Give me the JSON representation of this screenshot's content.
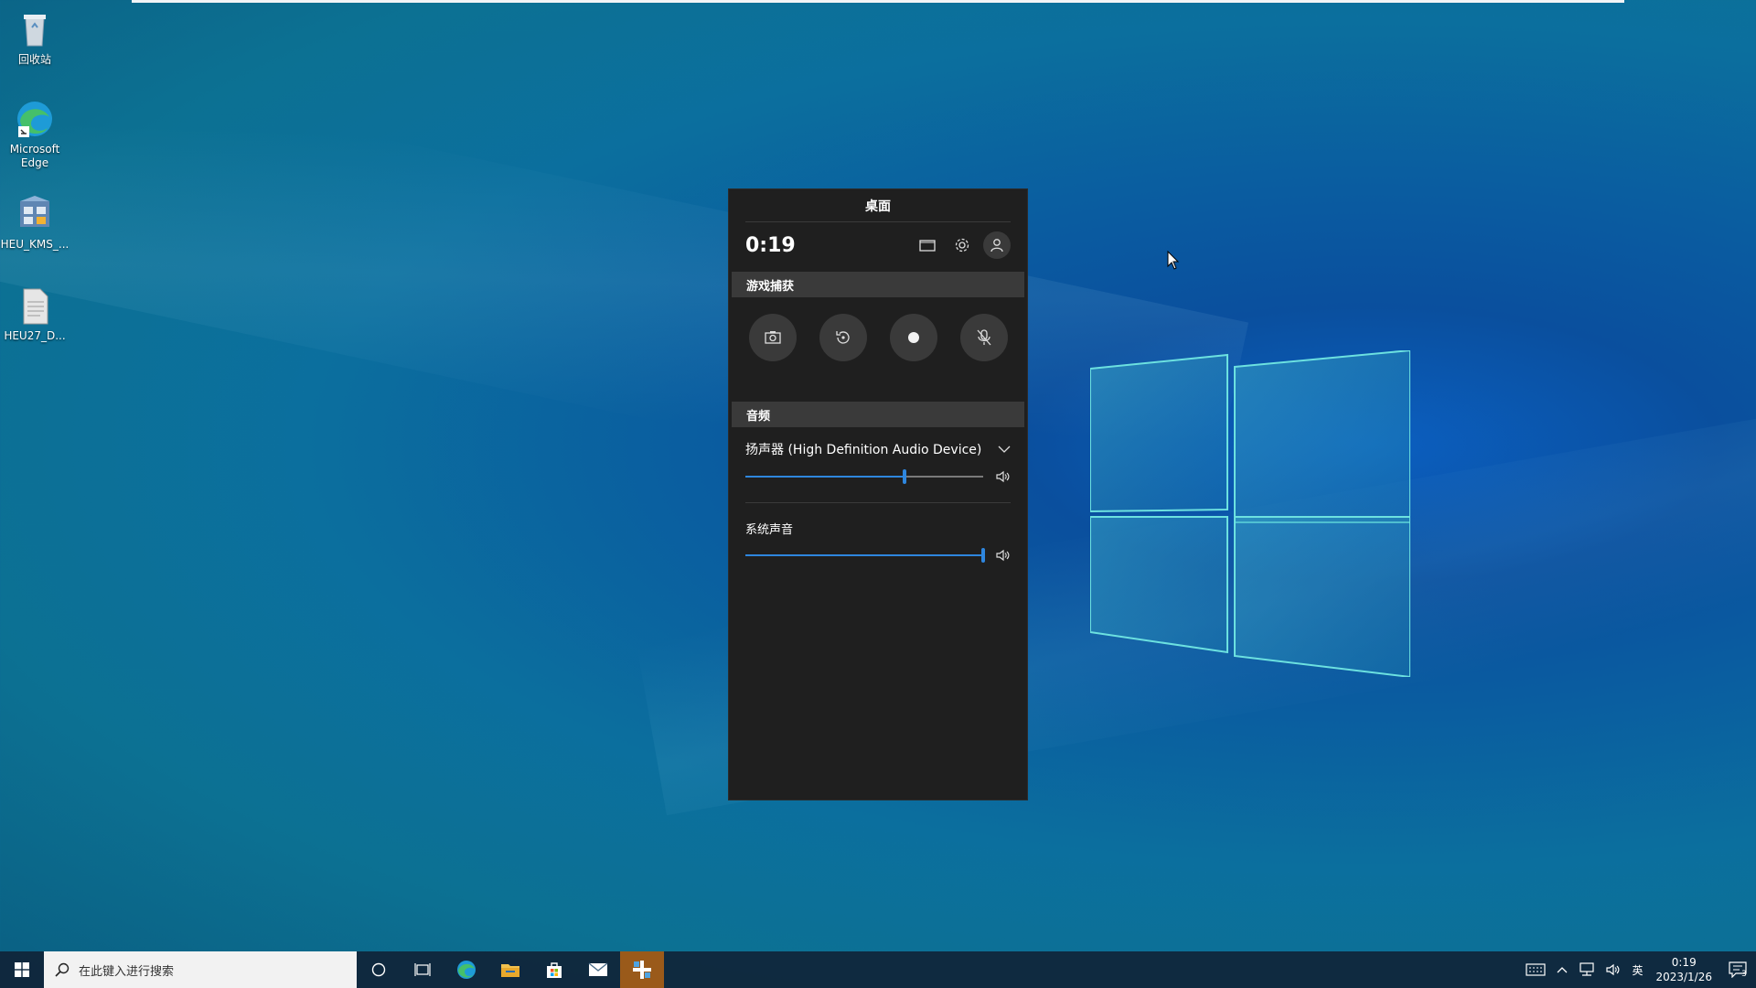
{
  "desktop": {
    "icons": [
      {
        "label": "回收站",
        "icon": "recycle-bin-icon"
      },
      {
        "label": "Microsoft Edge",
        "icon": "edge-icon"
      },
      {
        "label": "HEU_KMS_...",
        "icon": "kms-activator-icon"
      },
      {
        "label": "HEU27_D...",
        "icon": "document-icon"
      }
    ]
  },
  "gamebar": {
    "title": "桌面",
    "elapsed": "0:19",
    "capture": {
      "section_label": "游戏捕获",
      "buttons": [
        "screenshot",
        "record-last",
        "record",
        "mic-off"
      ]
    },
    "audio": {
      "section_label": "音频",
      "device": "扬声器 (High Definition Audio Device)",
      "device_volume": 0.67,
      "system_label": "系统声音",
      "system_volume": 1.0
    }
  },
  "taskbar": {
    "search_placeholder": "在此键入进行搜索",
    "apps": [
      "cortana-icon",
      "task-view-icon",
      "edge-icon",
      "file-explorer-icon",
      "store-icon",
      "mail-icon",
      "xbox-game-bar-icon"
    ],
    "tray": {
      "ime_label": "英",
      "time": "0:19",
      "date": "2023/1/26",
      "notification_count": "3"
    }
  },
  "colors": {
    "accent": "#2e86de",
    "panel": "#1f1f1f",
    "section": "#3a3a3a",
    "active_app": "#9a5a1a"
  }
}
